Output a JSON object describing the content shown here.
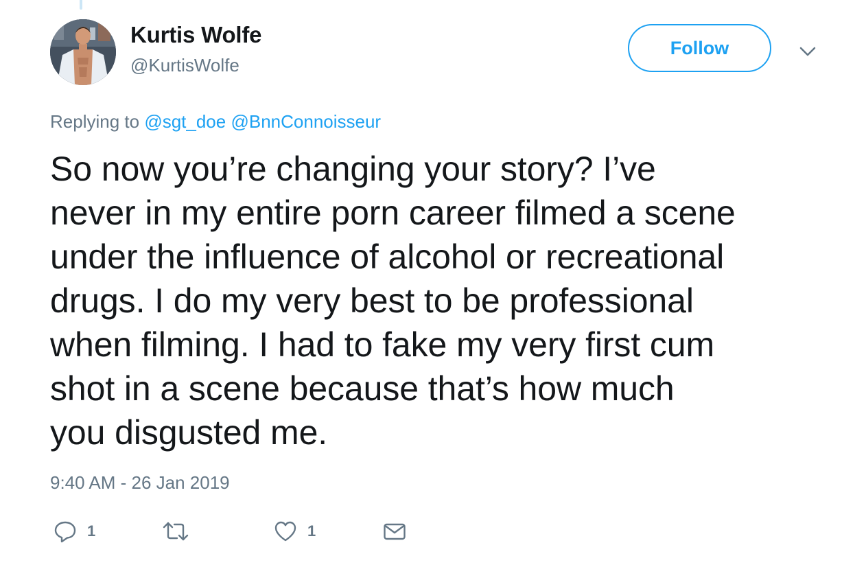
{
  "colors": {
    "accent": "#1da1f2",
    "text": "#14171a",
    "secondary": "#657786"
  },
  "author": {
    "display_name": "Kurtis Wolfe",
    "handle": "@KurtisWolfe",
    "avatar_icon": "profile-photo"
  },
  "header": {
    "follow_label": "Follow",
    "more_icon": "chevron-down-icon"
  },
  "reply_context": {
    "prefix": "Replying to",
    "mentions": [
      "@sgt_doe",
      "@BnnConnoisseur"
    ]
  },
  "tweet": {
    "text": "So now you’re changing your story? I’ve\nnever in my entire porn career filmed a scene\nunder the influence of alcohol or recreational\ndrugs. I do my very best to be professional\nwhen filming. I had to fake my very first cum\nshot in a scene because that’s how much\nyou disgusted me.",
    "timestamp": "9:40 AM - 26 Jan 2019"
  },
  "actions": {
    "reply": {
      "icon": "reply-icon",
      "count": "1"
    },
    "retweet": {
      "icon": "retweet-icon",
      "count": ""
    },
    "like": {
      "icon": "heart-icon",
      "count": "1"
    },
    "message": {
      "icon": "envelope-icon"
    }
  }
}
